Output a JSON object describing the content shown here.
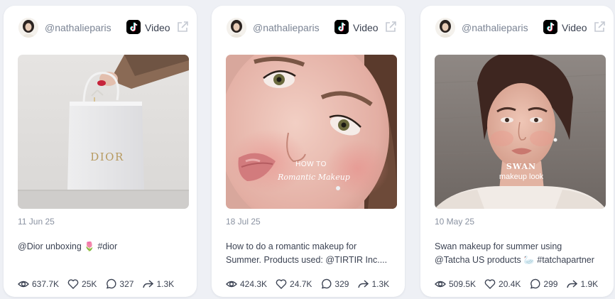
{
  "colors": {
    "page_background": "#eef0f5",
    "card_background": "#ffffff",
    "handle_text": "#7b8494",
    "body_text": "#3c4353",
    "muted_text": "#8a92a1"
  },
  "cards": [
    {
      "handle": "@nathalieparis",
      "platform_icon": "tiktok-icon",
      "type": "Video",
      "thumbnail": {
        "description_icon": "dior-shopping-bag",
        "brand_text": "DIOR",
        "overlay_title": "",
        "overlay_subtitle": ""
      },
      "date": "11 Jun 25",
      "caption_lines": [
        "@Dior unboxing 🌷 #dior"
      ],
      "stats": {
        "views": "637.7K",
        "likes": "25K",
        "comments": "327",
        "shares": "1.3K"
      }
    },
    {
      "handle": "@nathalieparis",
      "platform_icon": "tiktok-icon",
      "type": "Video",
      "thumbnail": {
        "description_icon": "makeup-portrait",
        "brand_text": "",
        "overlay_title": "HOW TO",
        "overlay_subtitle": "Romantic Makeup"
      },
      "date": "18 Jul 25",
      "caption_lines": [
        "How to do a romantic makeup for",
        "Summer. Products used: @TIRTIR Inc...."
      ],
      "stats": {
        "views": "424.3K",
        "likes": "24.7K",
        "comments": "329",
        "shares": "1.3K"
      }
    },
    {
      "handle": "@nathalieparis",
      "platform_icon": "tiktok-icon",
      "type": "Video",
      "thumbnail": {
        "description_icon": "makeup-portrait",
        "brand_text": "",
        "overlay_title": "SWAN",
        "overlay_subtitle": "makeup look"
      },
      "date": "10 May 25",
      "caption_lines": [
        "Swan makeup for summer using",
        "@Tatcha US products 🦢 #tatchapartner"
      ],
      "stats": {
        "views": "509.5K",
        "likes": "20.4K",
        "comments": "299",
        "shares": "1.9K"
      }
    }
  ]
}
